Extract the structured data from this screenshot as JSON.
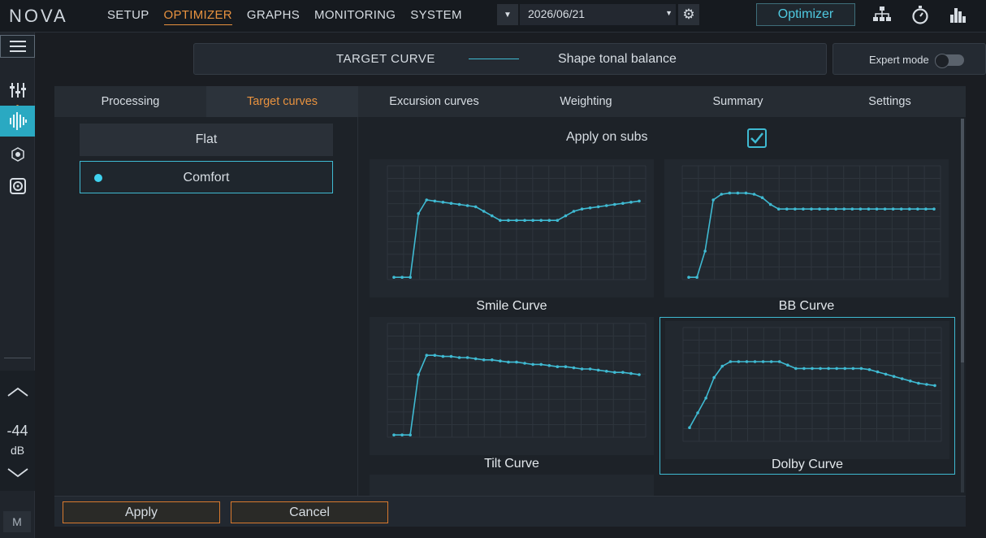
{
  "app": {
    "logo": "NOVA"
  },
  "nav": [
    {
      "label": "SETUP",
      "active": false
    },
    {
      "label": "OPTIMIZER",
      "active": true
    },
    {
      "label": "GRAPHS",
      "active": false
    },
    {
      "label": "MONITORING",
      "active": false
    },
    {
      "label": "SYSTEM",
      "active": false
    }
  ],
  "topbar": {
    "date": "2026/06/21",
    "mode_button": "Optimizer",
    "icons": [
      "network-icon",
      "stopwatch-icon",
      "bar-graph-icon"
    ]
  },
  "header": {
    "title": "TARGET CURVE",
    "subtitle": "Shape tonal balance",
    "expert_mode_label": "Expert mode",
    "expert_mode_on": false
  },
  "tabs": [
    {
      "label": "Processing",
      "active": false
    },
    {
      "label": "Target curves",
      "active": true
    },
    {
      "label": "Excursion curves",
      "active": false
    },
    {
      "label": "Weighting",
      "active": false
    },
    {
      "label": "Summary",
      "active": false
    },
    {
      "label": "Settings",
      "active": false
    }
  ],
  "presets": [
    {
      "label": "Flat",
      "selected": false
    },
    {
      "label": "Comfort",
      "selected": true
    }
  ],
  "apply_on_subs": {
    "label": "Apply on subs",
    "checked": true
  },
  "curves": [
    {
      "name": "Smile Curve",
      "selected": false,
      "points": [
        0.02,
        0.02,
        0.02,
        0.58,
        0.7,
        0.69,
        0.68,
        0.67,
        0.66,
        0.65,
        0.64,
        0.6,
        0.56,
        0.52,
        0.52,
        0.52,
        0.52,
        0.52,
        0.52,
        0.52,
        0.52,
        0.56,
        0.6,
        0.62,
        0.63,
        0.64,
        0.65,
        0.66,
        0.67,
        0.68,
        0.69
      ]
    },
    {
      "name": "BB Curve",
      "selected": false,
      "points": [
        0.02,
        0.02,
        0.25,
        0.7,
        0.75,
        0.76,
        0.76,
        0.76,
        0.75,
        0.72,
        0.66,
        0.62,
        0.62,
        0.62,
        0.62,
        0.62,
        0.62,
        0.62,
        0.62,
        0.62,
        0.62,
        0.62,
        0.62,
        0.62,
        0.62,
        0.62,
        0.62,
        0.62,
        0.62,
        0.62,
        0.62
      ]
    },
    {
      "name": "Tilt Curve",
      "selected": false,
      "points": [
        0.02,
        0.02,
        0.02,
        0.55,
        0.72,
        0.72,
        0.71,
        0.71,
        0.7,
        0.7,
        0.69,
        0.68,
        0.68,
        0.67,
        0.66,
        0.66,
        0.65,
        0.64,
        0.64,
        0.63,
        0.62,
        0.62,
        0.61,
        0.6,
        0.6,
        0.59,
        0.58,
        0.57,
        0.57,
        0.56,
        0.55
      ]
    },
    {
      "name": "Dolby Curve",
      "selected": true,
      "points": [
        0.12,
        0.25,
        0.38,
        0.56,
        0.66,
        0.7,
        0.7,
        0.7,
        0.7,
        0.7,
        0.7,
        0.7,
        0.67,
        0.64,
        0.64,
        0.64,
        0.64,
        0.64,
        0.64,
        0.64,
        0.64,
        0.64,
        0.63,
        0.61,
        0.59,
        0.57,
        0.55,
        0.53,
        0.51,
        0.5,
        0.49
      ]
    }
  ],
  "volume": {
    "value": "-44",
    "unit": "dB"
  },
  "rail_icons": [
    "faders-icon",
    "waveform-icon",
    "network-node-icon",
    "speaker-icon"
  ],
  "m_button": "M",
  "footer": {
    "apply_label": "Apply",
    "cancel_label": "Cancel"
  },
  "colors": {
    "accent": "#3fbad2",
    "active_nav": "#e8923f",
    "button_border": "#d97a2e"
  }
}
